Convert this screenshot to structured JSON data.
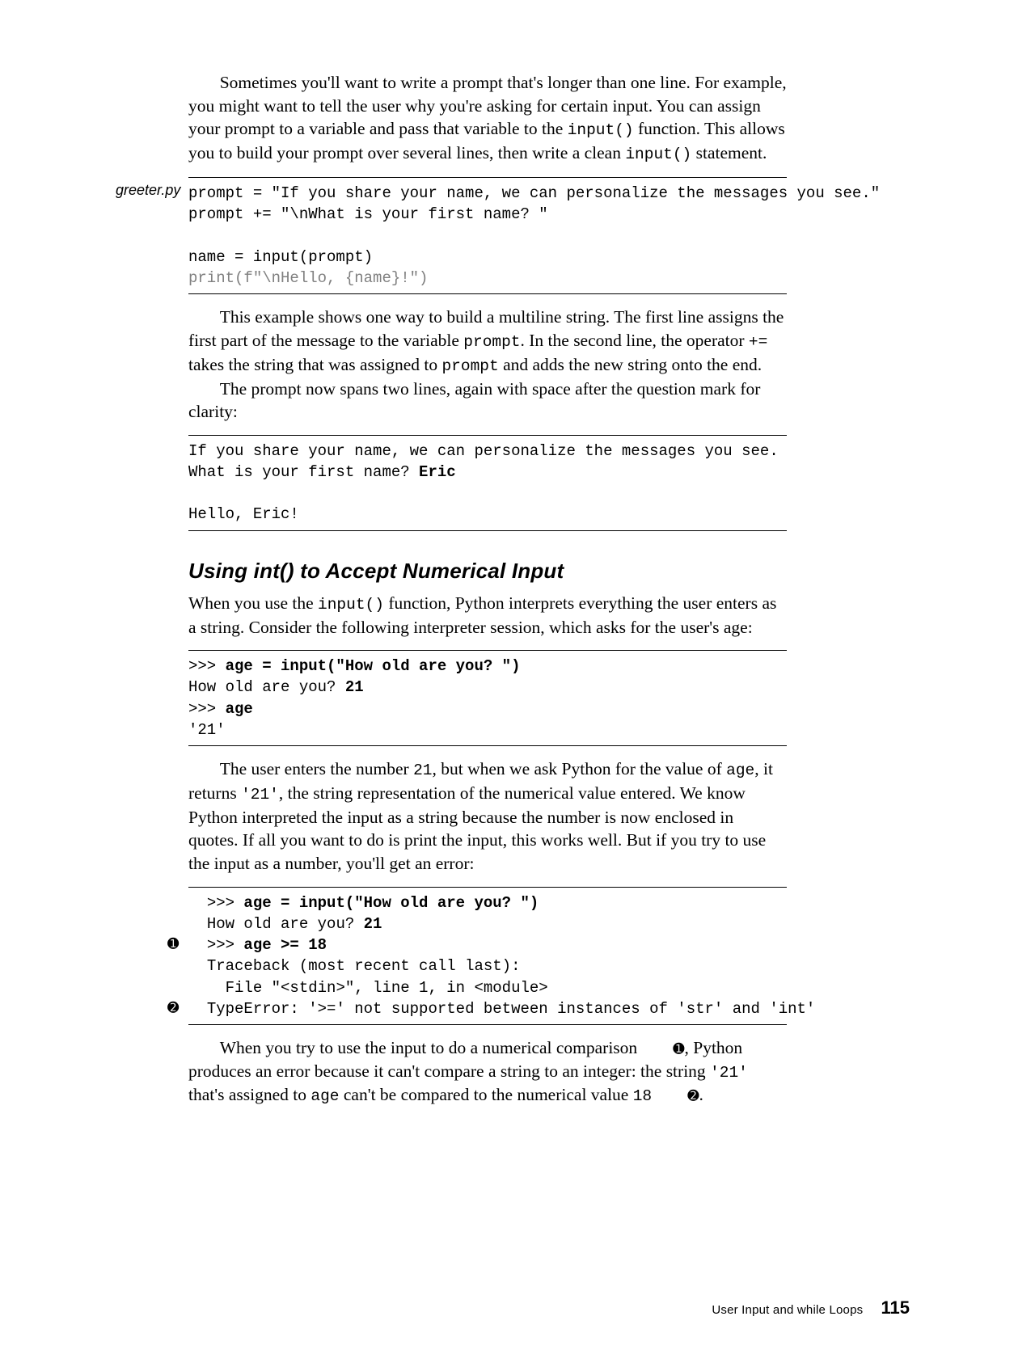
{
  "para1": "Sometimes you'll want to write a prompt that's longer than one line. For example, you might want to tell the user why you're asking for certain input. You can assign your prompt to a variable and pass that variable to the ",
  "para1_code": "input()",
  "para1_b": " function. This allows you to build your prompt over several lines, then write a clean ",
  "para1_code2": "input()",
  "para1_c": " statement.",
  "file1": "greeter.py",
  "code1_l1": "prompt = \"If you share your name, we can personalize the messages you see.\"",
  "code1_l2": "prompt += \"\\nWhat is your first name? \"",
  "code1_l3": "",
  "code1_l4": "name = input(prompt)",
  "code1_l5": "print(f\"\\nHello, {name}!\")",
  "para2a": "This example shows one way to build a multiline string. The first line assigns the first part of the message to the variable ",
  "para2a_c1": "prompt",
  "para2a_b": ". In the second line, the operator ",
  "para2a_c2": "+=",
  "para2a_c": " takes the string that was assigned to ",
  "para2a_c3": "prompt",
  "para2a_d": " and adds the new string onto the end.",
  "para2b": "The prompt now spans two lines, again with space after the question mark for clarity:",
  "code2_l1": "If you share your name, we can personalize the messages you see.",
  "code2_l2a": "What is your first name? ",
  "code2_l2b": "Eric",
  "code2_l3": "",
  "code2_l4": "Hello, Eric!",
  "heading1": "Using int() to Accept Numerical Input",
  "para3a": "When you use the ",
  "para3a_c1": "input()",
  "para3a_b": " function, Python interprets everything the user enters as a string. Consider the following interpreter session, which asks for the user's age:",
  "code3_l1a": ">>> ",
  "code3_l1b": "age = input(\"How old are you? \")",
  "code3_l2a": "How old are you? ",
  "code3_l2b": "21",
  "code3_l3a": ">>> ",
  "code3_l3b": "age",
  "code3_l4": "'21'",
  "para4a": "The user enters the number ",
  "para4a_c1": "21",
  "para4a_b": ", but when we ask Python for the value of ",
  "para4a_c2": "age",
  "para4a_c": ", it returns ",
  "para4a_c3": "'21'",
  "para4a_d": ", the string representation of the numerical value entered. We know Python interpreted the input as a string because the number is now enclosed in quotes. If all you want to do is print the input, this works well. But if you try to use the input as a number, you'll get an error:",
  "callout1": "➊",
  "callout2": "➋",
  "code4_l1a": ">>> ",
  "code4_l1b": "age = input(\"How old are you? \")",
  "code4_l2a": "How old are you? ",
  "code4_l2b": "21",
  "code4_l3a": ">>> ",
  "code4_l3b": "age >= 18",
  "code4_l4": "Traceback (most recent call last):",
  "code4_l5": "  File \"<stdin>\", line 1, in <module>",
  "code4_l6": "TypeError: '>=' not supported between instances of 'str' and 'int'",
  "para5a": "When you try to use the input to do a numerical comparison ",
  "para5a_d1": "➊",
  "para5a_b": ", Python produces an error because it can't compare a string to an integer: the string ",
  "para5a_c1": "'21'",
  "para5a_c": " that's assigned to ",
  "para5a_c2": "age",
  "para5a_d": " can't be compared to the numerical value ",
  "para5a_c3": "18",
  "para5a_e": " ",
  "para5a_d2": "➋",
  "para5a_f": ".",
  "footer_title": "User Input and while Loops",
  "footer_page": "115"
}
